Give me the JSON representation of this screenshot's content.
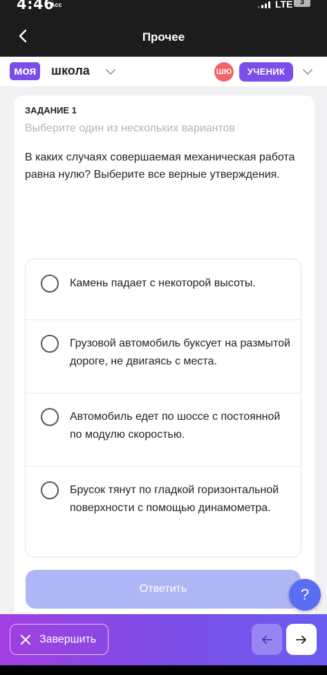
{
  "status_bar": {
    "time": "4:46",
    "sub": "Acc",
    "network": "LTE",
    "battery": "3"
  },
  "header": {
    "title": "Прочее"
  },
  "brand": {
    "logo_left": "моя",
    "logo_right": "школа",
    "avatar_initials": "ШЮ",
    "role": "УЧЕНИК"
  },
  "task": {
    "label": "ЗАДАНИЕ 1",
    "hint": "Выберите один из нескольких вариантов",
    "question": "В каких случаях совершаемая механическая работа равна нулю? Выберите все верные утверждения.",
    "options": [
      {
        "text": "Камень падает с некоторой высоты."
      },
      {
        "text": "Грузовой автомобиль буксует на размытой дороге, не двигаясь с места."
      },
      {
        "text": "Автомобиль едет по шоссе с постоянной по модулю скоростью."
      },
      {
        "text": "Брусок тянут по гладкой горизонтальной поверхности с помощью динамометра."
      }
    ],
    "answer_button": "Ответить"
  },
  "help": {
    "label": "?"
  },
  "footer": {
    "finish_label": "Завершить"
  },
  "colors": {
    "brand_purple": "#7a4ee8",
    "avatar_red": "#f06468",
    "answer_disabled": "#aeb6f5",
    "help_blue": "#5b6df2"
  }
}
